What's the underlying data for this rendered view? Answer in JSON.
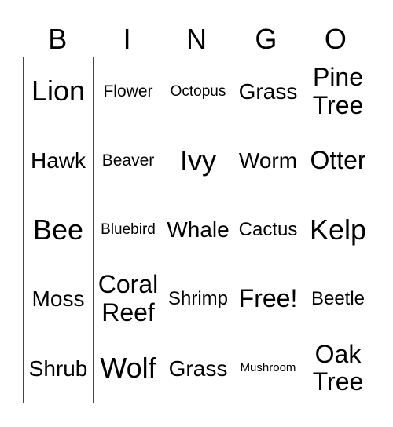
{
  "header": [
    "B",
    "I",
    "N",
    "G",
    "O"
  ],
  "rows": [
    [
      {
        "text": "Lion",
        "size": "s-xl"
      },
      {
        "text": "Flower",
        "size": "s-xs"
      },
      {
        "text": "Octopus",
        "size": "s-xxs"
      },
      {
        "text": "Grass",
        "size": "s-m"
      },
      {
        "text": "Pine Tree",
        "size": "s-l"
      }
    ],
    [
      {
        "text": "Hawk",
        "size": "s-m"
      },
      {
        "text": "Beaver",
        "size": "s-xs"
      },
      {
        "text": "Ivy",
        "size": "s-xl"
      },
      {
        "text": "Worm",
        "size": "s-m"
      },
      {
        "text": "Otter",
        "size": "s-l"
      }
    ],
    [
      {
        "text": "Bee",
        "size": "s-xl"
      },
      {
        "text": "Bluebird",
        "size": "s-xxs"
      },
      {
        "text": "Whale",
        "size": "s-m"
      },
      {
        "text": "Cactus",
        "size": "s-s"
      },
      {
        "text": "Kelp",
        "size": "s-xl"
      }
    ],
    [
      {
        "text": "Moss",
        "size": "s-m"
      },
      {
        "text": "Coral Reef",
        "size": "s-l"
      },
      {
        "text": "Shrimp",
        "size": "s-s"
      },
      {
        "text": "Free!",
        "size": "s-l"
      },
      {
        "text": "Beetle",
        "size": "s-s"
      }
    ],
    [
      {
        "text": "Shrub",
        "size": "s-m"
      },
      {
        "text": "Wolf",
        "size": "s-xl"
      },
      {
        "text": "Grass",
        "size": "s-m"
      },
      {
        "text": "Mushroom",
        "size": "s-tiny"
      },
      {
        "text": "Oak Tree",
        "size": "s-l"
      }
    ]
  ]
}
